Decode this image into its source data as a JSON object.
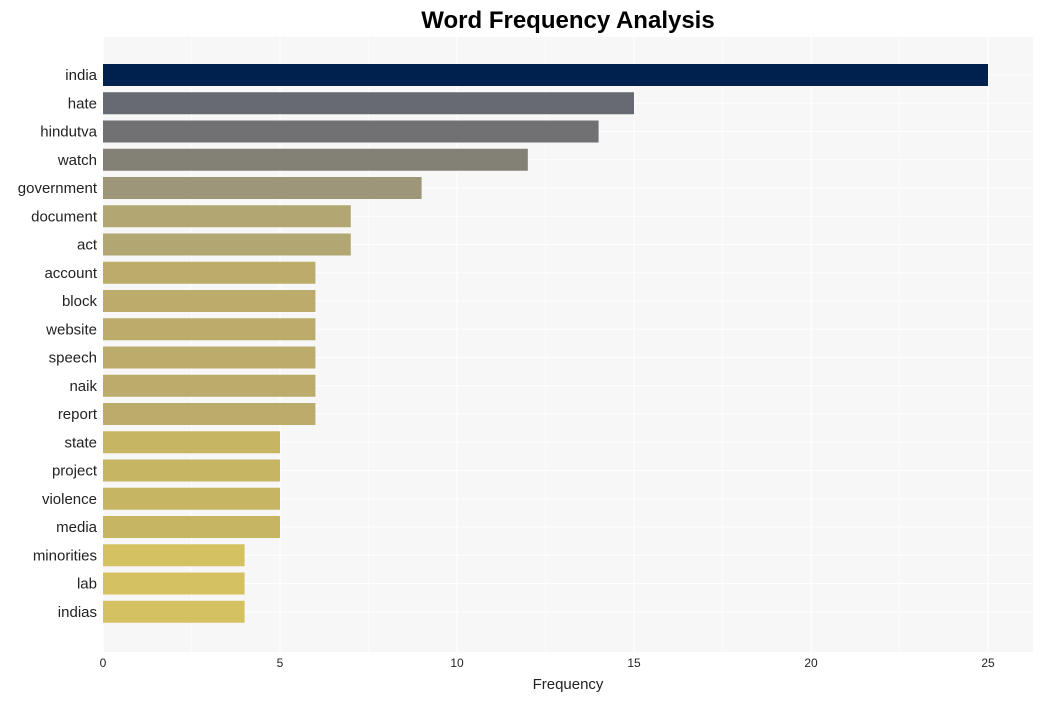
{
  "chart_data": {
    "type": "bar",
    "orientation": "horizontal",
    "title": "Word Frequency Analysis",
    "xlabel": "Frequency",
    "ylabel": "",
    "xlim": [
      0,
      26.2
    ],
    "xticks": [
      0,
      5,
      10,
      15,
      20,
      25
    ],
    "grid": true,
    "legend": "none",
    "categories": [
      "india",
      "hate",
      "hindutva",
      "watch",
      "government",
      "document",
      "act",
      "account",
      "block",
      "website",
      "speech",
      "naik",
      "report",
      "state",
      "project",
      "violence",
      "media",
      "minorities",
      "lab",
      "indias"
    ],
    "values": [
      25,
      15,
      14,
      12,
      9,
      7,
      7,
      6,
      6,
      6,
      6,
      6,
      6,
      5,
      5,
      5,
      5,
      4,
      4,
      4
    ],
    "colors": [
      "#00214d",
      "#686a72",
      "#717174",
      "#838075",
      "#9e9678",
      "#b2a772",
      "#b2a772",
      "#bcac6c",
      "#bcac6c",
      "#bcac6c",
      "#bcac6c",
      "#bcac6c",
      "#bcac6c",
      "#c6b664",
      "#c6b664",
      "#c6b664",
      "#c6b664",
      "#d4c262",
      "#d4c262",
      "#d4c262"
    ],
    "plot_background": "#f7f7f7",
    "grid_color": "#ffffff"
  }
}
